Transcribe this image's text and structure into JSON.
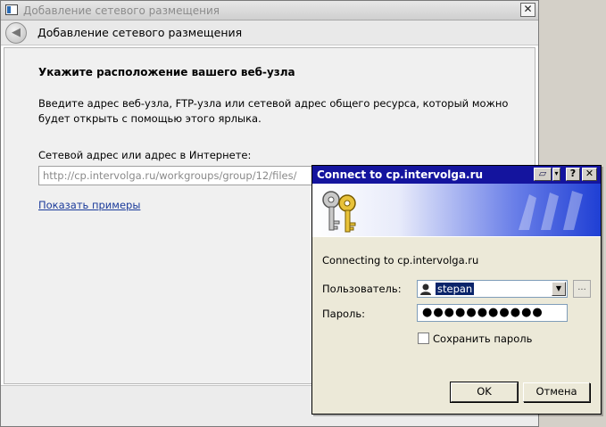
{
  "wizard": {
    "window_title": "Добавление сетевого размещения",
    "close_glyph": "✕",
    "header_title": "Добавление сетевого размещения",
    "back_glyph": "◀",
    "section_heading": "Укажите расположение вашего веб-узла",
    "description": "Введите адрес веб-узла, FTP-узла или сетевой адрес общего ресурса, который можно будет открыть с помощью этого ярлыка.",
    "address_label": "Сетевой адрес или адрес в Интернете:",
    "address_value": "http://cp.intervolga.ru/workgroups/group/12/files/",
    "show_examples": "Показать примеры"
  },
  "dialog": {
    "title": "Connect to cp.intervolga.ru",
    "lang_glyph": "▱",
    "menu_glyph": "▾",
    "help_glyph": "?",
    "close_glyph": "✕",
    "connecting_text": "Connecting to cp.intervolga.ru",
    "user_label": "Пользователь:",
    "user_value": "stepan",
    "dropdown_glyph": "▼",
    "browse_label": "...",
    "password_label": "Пароль:",
    "password_value": "●●●●●●●●●●●",
    "save_password_label": "Сохранить пароль",
    "save_password_checked": false,
    "ok_label": "OK",
    "cancel_label": "Отмена"
  },
  "colors": {
    "dialog_titlebar": "#14149e",
    "link": "#1a3a9a",
    "selection": "#0a246a"
  }
}
